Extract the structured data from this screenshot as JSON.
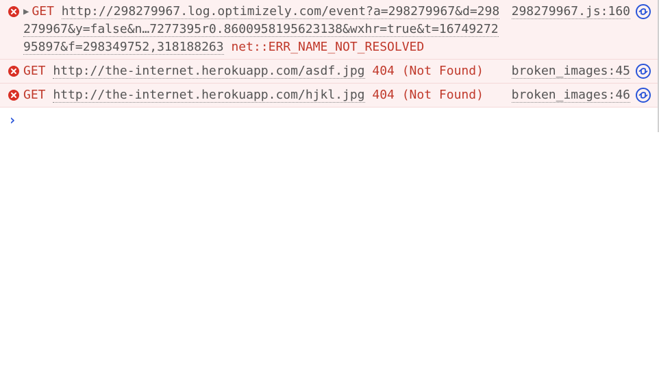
{
  "entries": [
    {
      "method": "GET",
      "has_disclosure": true,
      "url": "http://298279967.log.optimizely.com/event?a=298279967&d=298279967&y=false&n…7277395r0.8600958195623138&wxhr=true&t=1674927295897&f=298349752,318188263",
      "status": "net::ERR_NAME_NOT_RESOLVED",
      "source": "298279967.js:160"
    },
    {
      "method": "GET",
      "has_disclosure": false,
      "url": "http://the-internet.herokuapp.com/asdf.jpg",
      "status": "404 (Not Found)",
      "source": "broken_images:45"
    },
    {
      "method": "GET",
      "has_disclosure": false,
      "url": "http://the-internet.herokuapp.com/hjkl.jpg",
      "status": "404 (Not Found)",
      "source": "broken_images:46"
    }
  ],
  "prompt_symbol": "›"
}
